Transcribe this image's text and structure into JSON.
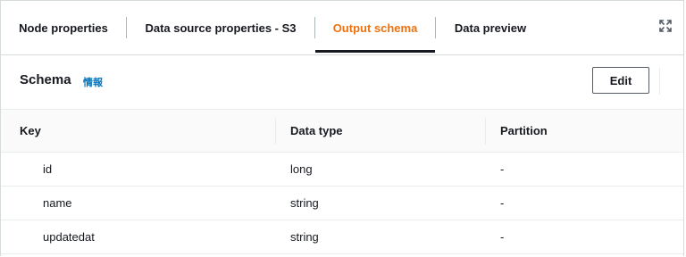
{
  "tabs": [
    {
      "label": "Node properties",
      "active": false
    },
    {
      "label": "Data source properties - S3",
      "active": false
    },
    {
      "label": "Output schema",
      "active": true
    },
    {
      "label": "Data preview",
      "active": false
    }
  ],
  "expand_icon": "expand-arrows-icon",
  "header": {
    "title": "Schema",
    "info_label": "情報",
    "edit_label": "Edit"
  },
  "table": {
    "columns": [
      "Key",
      "Data type",
      "Partition"
    ],
    "rows": [
      {
        "key": "id",
        "type": "long",
        "partition": "-"
      },
      {
        "key": "name",
        "type": "string",
        "partition": "-"
      },
      {
        "key": "updatedat",
        "type": "string",
        "partition": "-"
      }
    ]
  },
  "colors": {
    "active_tab": "#ec7211",
    "link": "#0073bb",
    "border": "#d5dbdb"
  }
}
